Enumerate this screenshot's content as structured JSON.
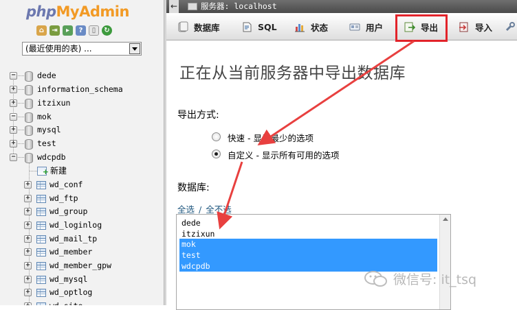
{
  "logo": {
    "php": "php",
    "myadmin": "MyAdmin"
  },
  "quick_icons": [
    {
      "name": "home-icon",
      "color": "#d9a54a"
    },
    {
      "name": "logout-icon",
      "color": "#7a9c3f"
    },
    {
      "name": "query-window-icon",
      "color": "#5aa05a"
    },
    {
      "name": "docs-icon",
      "color": "#6a8bc5"
    },
    {
      "name": "info-icon",
      "color": "#9a9a9a"
    },
    {
      "name": "reload-icon",
      "color": "#3d9a3d"
    }
  ],
  "db_select": {
    "value": "(最近使用的表) ..."
  },
  "databases": [
    {
      "label": "dede",
      "expander": "−"
    },
    {
      "label": "information_schema",
      "expander": "+"
    },
    {
      "label": "itzixun",
      "expander": "+"
    },
    {
      "label": "mok",
      "expander": "−"
    },
    {
      "label": "mysql",
      "expander": "+"
    },
    {
      "label": "test",
      "expander": "+"
    },
    {
      "label": "wdcpdb",
      "expander": "−"
    }
  ],
  "new_label": "新建",
  "tables": [
    "wd_conf",
    "wd_ftp",
    "wd_group",
    "wd_loginlog",
    "wd_mail_tp",
    "wd_member",
    "wd_member_gpw",
    "wd_mysql",
    "wd_optlog",
    "wd_site"
  ],
  "server_bar": {
    "back": "←",
    "text": "服务器: localhost"
  },
  "tabs": [
    {
      "label": "数据库",
      "icon": "database-icon"
    },
    {
      "label": "SQL",
      "icon": "sql-icon"
    },
    {
      "label": "状态",
      "icon": "status-icon"
    },
    {
      "label": "用户",
      "icon": "users-icon"
    },
    {
      "label": "导出",
      "icon": "export-icon"
    },
    {
      "label": "导入",
      "icon": "import-icon"
    }
  ],
  "heading": "正在从当前服务器中导出数据库",
  "export_method": {
    "title": "导出方式:",
    "options": [
      {
        "label": "快速 - 显示最少的选项",
        "checked": false
      },
      {
        "label": "自定义 - 显示所有可用的选项",
        "checked": true
      }
    ]
  },
  "database_section": {
    "title": "数据库:",
    "select_all": "全选",
    "separator": "/",
    "select_none": "全不选",
    "list": [
      {
        "label": "dede",
        "selected": false
      },
      {
        "label": "itzixun",
        "selected": false
      },
      {
        "label": "mok",
        "selected": true
      },
      {
        "label": "test",
        "selected": true
      },
      {
        "label": "wdcpdb",
        "selected": true
      }
    ]
  },
  "watermark": {
    "text": "微信号: it_tsq"
  },
  "colors": {
    "highlight_box": "#e2232a",
    "arrow": "#e8403f",
    "selection": "#3399ff",
    "link": "#235a81"
  }
}
